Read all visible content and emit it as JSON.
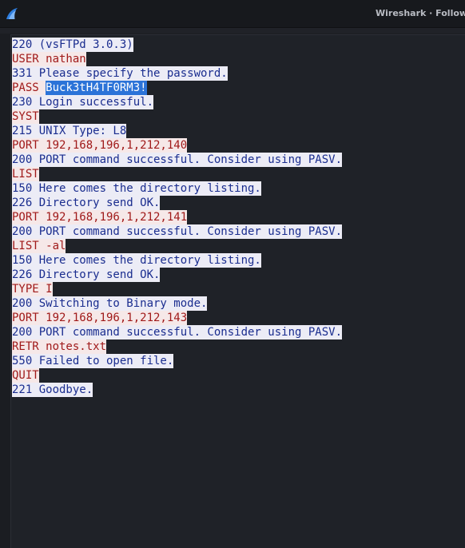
{
  "window": {
    "title": "Wireshark · Follow TC"
  },
  "colors": {
    "server_text": "#1a2d8f",
    "server_bg": "#ececf6",
    "client_text": "#a01a1a",
    "client_bg": "#f6e8e8",
    "selection_bg": "#2b73d8"
  },
  "stream": [
    {
      "dir": "server",
      "text": "220 (vsFTPd 3.0.3)"
    },
    {
      "dir": "client",
      "text": "USER nathan"
    },
    {
      "dir": "server",
      "text": "331 Please specify the password."
    },
    {
      "dir": "client",
      "text": "PASS ",
      "selected": "Buck3tH4TF0RM3!"
    },
    {
      "dir": "server",
      "text": "230 Login successful."
    },
    {
      "dir": "client",
      "text": "SYST"
    },
    {
      "dir": "server",
      "text": "215 UNIX Type: L8"
    },
    {
      "dir": "client",
      "text": "PORT 192,168,196,1,212,140"
    },
    {
      "dir": "server",
      "text": "200 PORT command successful. Consider using PASV."
    },
    {
      "dir": "client",
      "text": "LIST"
    },
    {
      "dir": "server",
      "text": "150 Here comes the directory listing."
    },
    {
      "dir": "server",
      "text": "226 Directory send OK."
    },
    {
      "dir": "client",
      "text": "PORT 192,168,196,1,212,141"
    },
    {
      "dir": "server",
      "text": "200 PORT command successful. Consider using PASV."
    },
    {
      "dir": "client",
      "text": "LIST -al"
    },
    {
      "dir": "server",
      "text": "150 Here comes the directory listing."
    },
    {
      "dir": "server",
      "text": "226 Directory send OK."
    },
    {
      "dir": "client",
      "text": "TYPE I"
    },
    {
      "dir": "server",
      "text": "200 Switching to Binary mode."
    },
    {
      "dir": "client",
      "text": "PORT 192,168,196,1,212,143"
    },
    {
      "dir": "server",
      "text": "200 PORT command successful. Consider using PASV."
    },
    {
      "dir": "client",
      "text": "RETR notes.txt"
    },
    {
      "dir": "server",
      "text": "550 Failed to open file."
    },
    {
      "dir": "client",
      "text": "QUIT"
    },
    {
      "dir": "server",
      "text": "221 Goodbye."
    }
  ]
}
